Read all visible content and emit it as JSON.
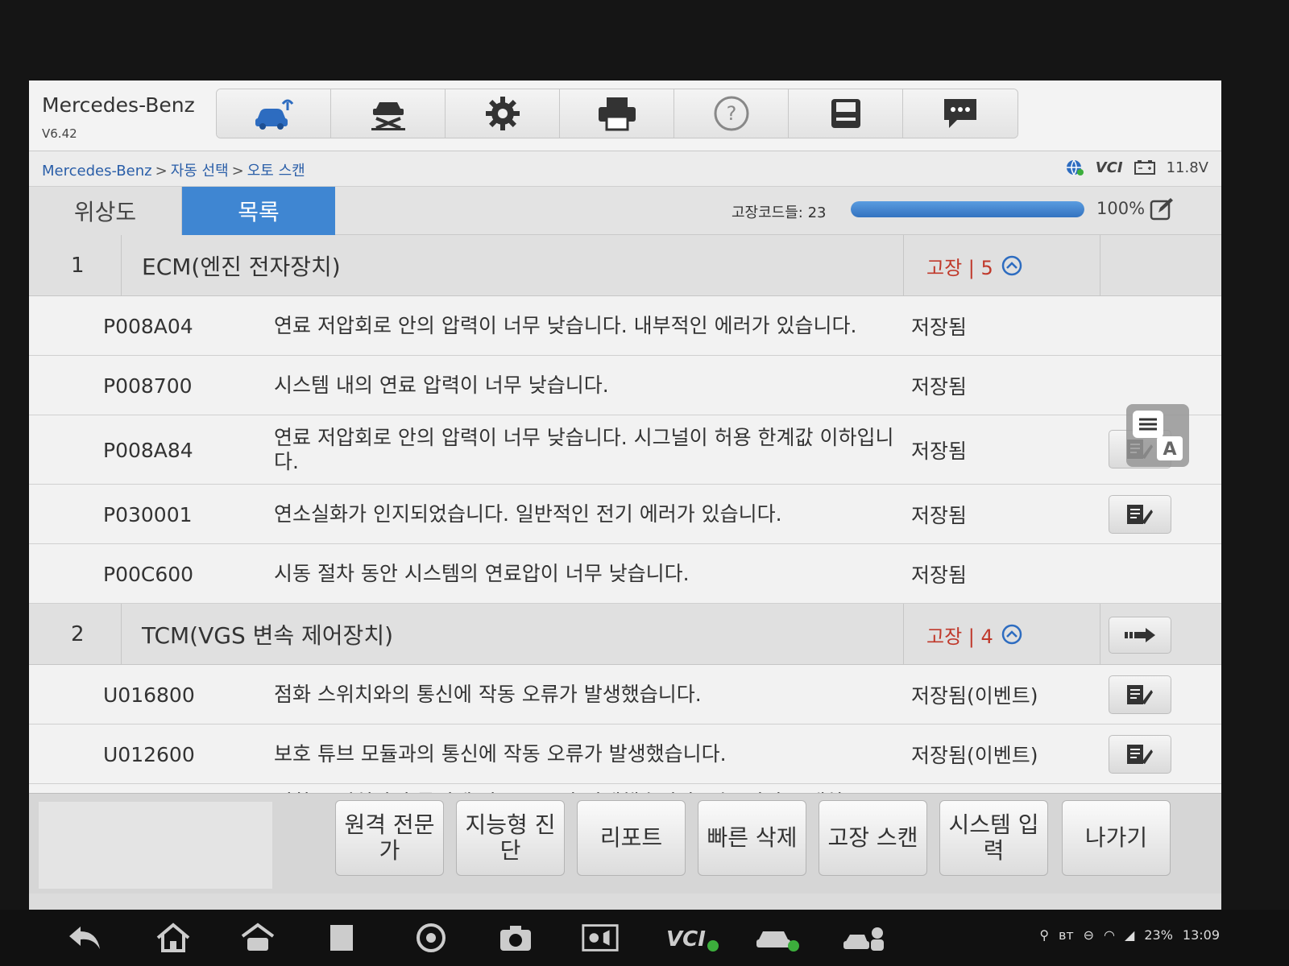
{
  "app": {
    "brand": "Mercedes-Benz",
    "version": "V6.42"
  },
  "toolbar": {
    "items": [
      {
        "icon": "remote-car-icon"
      },
      {
        "icon": "car-lift-icon"
      },
      {
        "icon": "gear-icon"
      },
      {
        "icon": "printer-icon"
      },
      {
        "icon": "help-icon"
      },
      {
        "icon": "save-icon"
      },
      {
        "icon": "chat-icon"
      }
    ]
  },
  "breadcrumb": {
    "items": [
      "Mercedes-Benz",
      "자동 선택",
      "오토 스캔"
    ],
    "separator": ">"
  },
  "status": {
    "vci": "VCI",
    "voltage": "11.8V"
  },
  "tabs": {
    "topology": "위상도",
    "list": "목록"
  },
  "summary": {
    "dtc_count_label": "고장코드들: 23",
    "progress": 100,
    "progress_label": "100%"
  },
  "systems": [
    {
      "number": "1",
      "name": "ECM(엔진 전자장치)",
      "fault_label": "고장 | 5",
      "dtcs": [
        {
          "code": "P008A04",
          "description": "연료 저압회로 안의 압력이 너무 낮습니다. 내부적인 에러가 있습니다.",
          "status": "저장됨"
        },
        {
          "code": "P008700",
          "description": "시스템 내의 연료 압력이 너무 낮습니다.",
          "status": "저장됨"
        },
        {
          "code": "P008A84",
          "description": "연료 저압회로 안의 압력이 너무 낮습니다. 시그널이 허용 한계값 이하입니다.",
          "status": "저장됨"
        },
        {
          "code": "P030001",
          "description": "연소실화가 인지되었습니다. 일반적인 전기 에러가 있습니다.",
          "status": "저장됨"
        },
        {
          "code": "P00C600",
          "description": "시동 절차 동안 시스템의 연료압이 너무 낮습니다.",
          "status": "저장됨"
        }
      ]
    },
    {
      "number": "2",
      "name": "TCM(VGS 변속 제어장치)",
      "fault_label": "고장 | 4",
      "dtcs": [
        {
          "code": "U016800",
          "description": "점화 스위치와의 통신에 작동 오류가 발생했습니다.",
          "status": "저장됨(이벤트)"
        },
        {
          "code": "U012600",
          "description": "보호 튜브 모듈과의 통신에 작동 오류가 발생했습니다.",
          "status": "저장됨(이벤트)"
        },
        {
          "code": "",
          "description": "점화 스위치와의 통신에 작동 오류가 발생했습니다. 시그널이 중재차",
          "status": ""
        }
      ]
    }
  ],
  "bottom_buttons": [
    "원격 전문가",
    "지능형 진단",
    "리포트",
    "빠른 삭제",
    "고장 스캔",
    "시스템 입력",
    "나가기"
  ],
  "android": {
    "battery": "23%",
    "time": "13:09"
  },
  "colors": {
    "accent": "#3f86d2",
    "fault": "#c0392b"
  }
}
